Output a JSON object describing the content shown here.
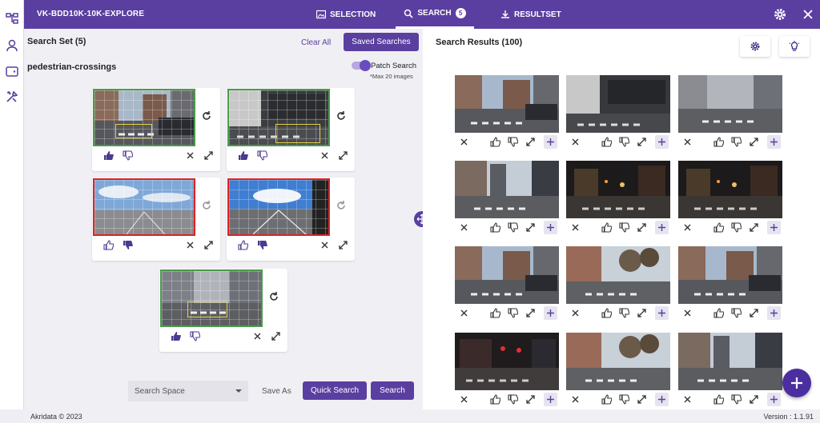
{
  "app": {
    "title": "VK-BDD10K-10K-EXPLORE"
  },
  "tabs": [
    {
      "label": "SELECTION",
      "icon": "image-icon"
    },
    {
      "label": "SEARCH",
      "badge": "5",
      "icon": "search-icon"
    },
    {
      "label": "RESULTSET",
      "icon": "download-icon"
    }
  ],
  "left": {
    "search_set_title": "Search Set (5)",
    "clear_all": "Clear All",
    "saved_searches": "Saved Searches",
    "query_name": "pedestrian-crossings",
    "patch_search_label": "Patch Search",
    "patch_search_note": "*Max 20 images",
    "patch_search_on": true,
    "cards": [
      {
        "border": "green",
        "patch": true,
        "scene": "city-day",
        "feedback": "like"
      },
      {
        "border": "green",
        "patch": true,
        "scene": "truck-night",
        "feedback": "like"
      },
      {
        "border": "red",
        "patch": false,
        "scene": "highway-sky",
        "feedback": "dislike"
      },
      {
        "border": "red",
        "patch": false,
        "scene": "road-sky",
        "feedback": "dislike"
      },
      {
        "border": "green",
        "patch": true,
        "scene": "overcast-street",
        "feedback": "like"
      }
    ],
    "search_space_placeholder": "Search Space",
    "save_as": "Save As",
    "quick_search": "Quick Search",
    "search": "Search"
  },
  "right": {
    "title": "Search Results (100)",
    "results": [
      {
        "scene": "city-day"
      },
      {
        "scene": "truck-night"
      },
      {
        "scene": "overcast-street"
      },
      {
        "scene": "tall-buildings"
      },
      {
        "scene": "night-street"
      },
      {
        "scene": "night-street"
      },
      {
        "scene": "city-day"
      },
      {
        "scene": "trees-street"
      },
      {
        "scene": "city-day"
      },
      {
        "scene": "red-lights-night"
      },
      {
        "scene": "trees-street"
      },
      {
        "scene": "tall-buildings"
      }
    ]
  },
  "footer": {
    "copyright": "Akridata © 2023",
    "version": "Version : 1.1.91"
  },
  "colors": {
    "brand": "#5a3fa0",
    "positive_border": "#4a9a4a",
    "negative_border": "#d22222",
    "patch": "#e8d048"
  }
}
